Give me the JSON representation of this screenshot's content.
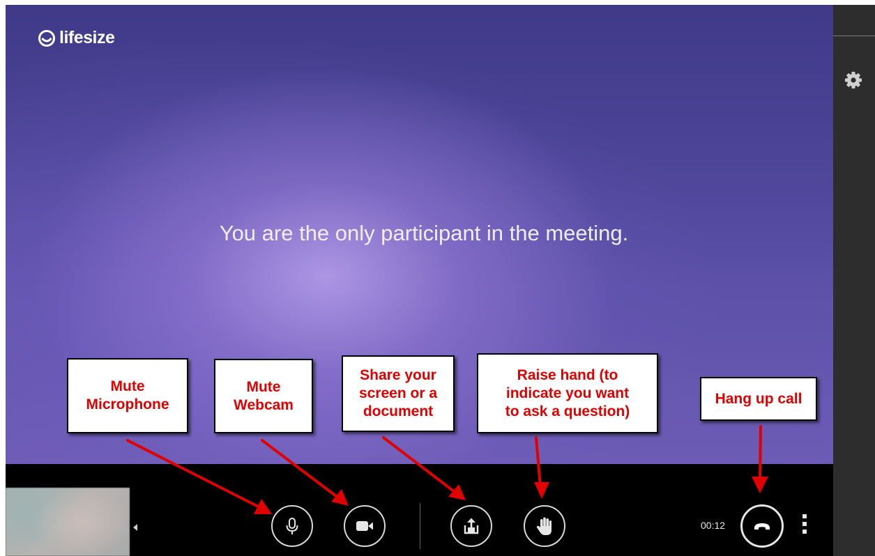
{
  "app": {
    "logo_text": "lifesize",
    "status_message": "You are the only participant in the meeting."
  },
  "sidebar": {
    "settings_icon": "gear-icon"
  },
  "controls": {
    "microphone_icon": "microphone-icon",
    "webcam_icon": "video-camera-icon",
    "share_icon": "share-upload-icon",
    "raise_hand_icon": "hand-icon",
    "hangup_icon": "phone-hangup-icon",
    "timer": "00:12",
    "more_icon": "vertical-ellipsis-icon",
    "hangup_color": "#ffffff"
  },
  "annotations": {
    "mute_microphone": "Mute\nMicrophone",
    "mute_webcam": "Mute\nWebcam",
    "share_screen": "Share your\nscreen or a\ndocument",
    "raise_hand": "Raise hand (to\nindicate you want\nto ask a question)",
    "hang_up": "Hang up call",
    "text_color": "#e00000"
  }
}
